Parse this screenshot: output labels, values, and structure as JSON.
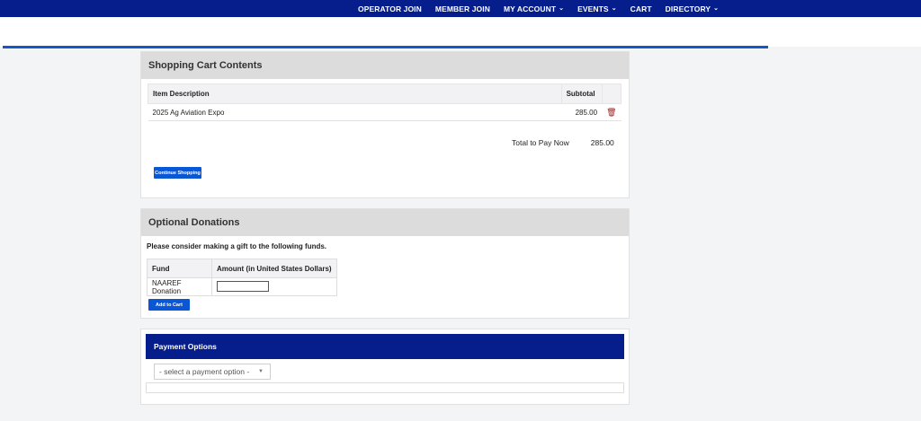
{
  "nav": {
    "items": [
      {
        "label": "OPERATOR JOIN",
        "caret": ""
      },
      {
        "label": "MEMBER JOIN",
        "caret": ""
      },
      {
        "label": "MY ACCOUNT",
        "caret": "⌄"
      },
      {
        "label": "EVENTS",
        "caret": "⌄"
      },
      {
        "label": "CART",
        "caret": ""
      },
      {
        "label": "DIRECTORY",
        "caret": "⌄"
      }
    ]
  },
  "cart": {
    "title": "Shopping Cart Contents",
    "columns": [
      "Item Description",
      "Subtotal"
    ],
    "rows": [
      {
        "description": "2025 Ag Aviation Expo",
        "subtotal": "285.00"
      }
    ],
    "total_label": "Total to Pay Now",
    "total_value": "285.00",
    "continue_label": "Continue Shopping"
  },
  "donations": {
    "title": "Optional Donations",
    "intro": "Please consider making a gift to the following funds.",
    "columns": [
      "Fund",
      "Amount (in United States Dollars)"
    ],
    "rows": [
      {
        "fund": "NAAREF Donation",
        "amount": ""
      }
    ],
    "add_label": "Add to Cart"
  },
  "payment": {
    "title": "Payment Options",
    "select_placeholder": "- select a payment option -"
  },
  "icons": {
    "delete": "trash-icon",
    "dropdown": "triangle-down-icon"
  },
  "colors": {
    "nav_bg": "#061d8c",
    "button": "#0a57d6",
    "accent_line": "#1457c8",
    "trash": "#8b1a1a"
  }
}
